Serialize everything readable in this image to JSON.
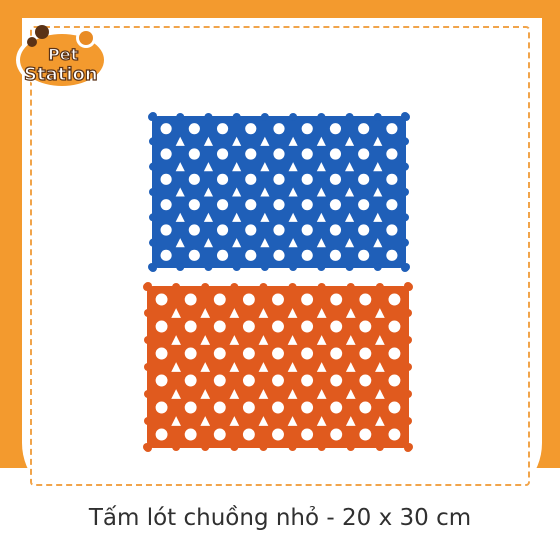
{
  "logo": {
    "line1": "Pet",
    "line2": "Station"
  },
  "product": {
    "title": "Tấm lót chuồng nhỏ - 20 x 30 cm"
  },
  "colors": {
    "background": "#f39a2e",
    "accent": "#f1a44a",
    "mat_blue": "#1f5fb8",
    "mat_orange": "#e05a1e",
    "text": "#303030"
  },
  "mats": [
    {
      "color_name": "blue"
    },
    {
      "color_name": "orange"
    }
  ]
}
